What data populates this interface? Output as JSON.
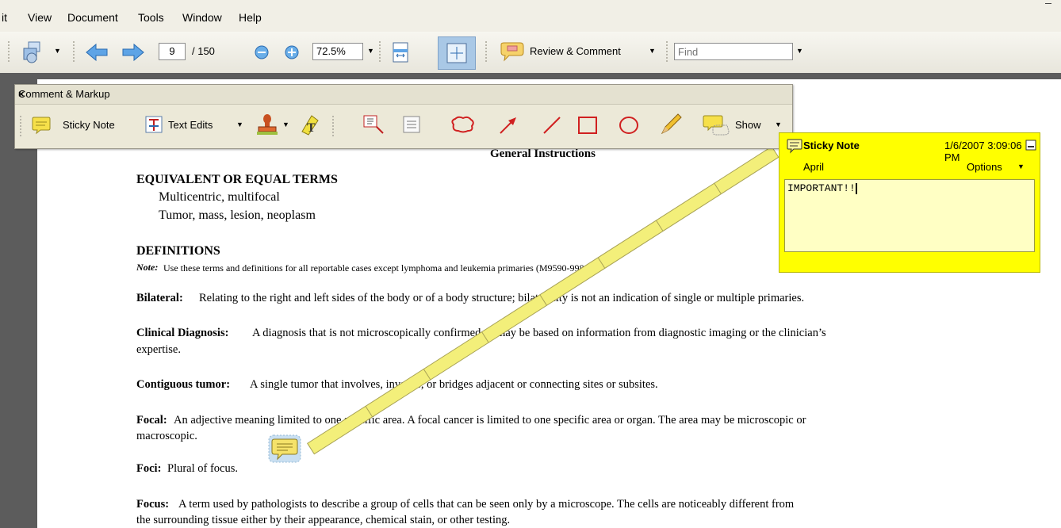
{
  "menubar": {
    "items": [
      "it",
      "View",
      "Document",
      "Tools",
      "Window",
      "Help"
    ]
  },
  "toolbar": {
    "page_current": "9",
    "page_total": "/ 150",
    "zoom": "72.5%",
    "review_label": "Review & Comment",
    "find_placeholder": "Find"
  },
  "comment_markup": {
    "title": "Comment & Markup",
    "close": "×",
    "sticky_note_label": "Sticky Note",
    "text_edits_label": "Text Edits",
    "show_label": "Show"
  },
  "sticky_note": {
    "title": "Sticky Note",
    "date": "1/6/2007 3:09:06 PM",
    "author": "April",
    "options_label": "Options",
    "body": "IMPORTANT!!"
  },
  "document": {
    "heading": "General Instructions",
    "section1_title": "EQUIVALENT OR EQUAL TERMS",
    "section1_lines": [
      "Multicentric, multifocal",
      "Tumor, mass, lesion, neoplasm"
    ],
    "section2_title": "DEFINITIONS",
    "note_label": "Note:",
    "note_text": "Use these terms and definitions for all reportable cases except lymphoma and leukemia primaries (M9590-9989).",
    "entries": [
      {
        "term": "Bilateral:",
        "text": "Relating to the right and left sides of the body or of a body structure; bilaterality is not an indication of single or multiple primaries."
      },
      {
        "term": "Clinical Diagnosis:",
        "text": "A diagnosis that is not microscopically confirmed. It may be based on information from diagnostic imaging or the clinician’s",
        "text2": "expertise."
      },
      {
        "term": "Contiguous tumor:",
        "text": "A single tumor that involves, invades, or bridges adjacent or connecting sites or subsites."
      },
      {
        "term": "Focal:",
        "text": "An adjective meaning limited to one specific area.  A focal cancer is limited to one specific area or organ.  The area may be microscopic or",
        "text2": "macroscopic."
      },
      {
        "term": "Foci:",
        "text": "Plural of focus."
      },
      {
        "term": "Focus:",
        "text": "A term used by pathologists to describe a group of cells that can be seen only by a microscope.  The cells are noticeably different from",
        "text2": "the surrounding tissue either by their appearance, chemical stain, or other testing."
      }
    ]
  },
  "colors": {
    "sticky_yellow": "#ffff00",
    "sticky_body": "#ffffc4",
    "highlight": "#f3ef7a"
  }
}
